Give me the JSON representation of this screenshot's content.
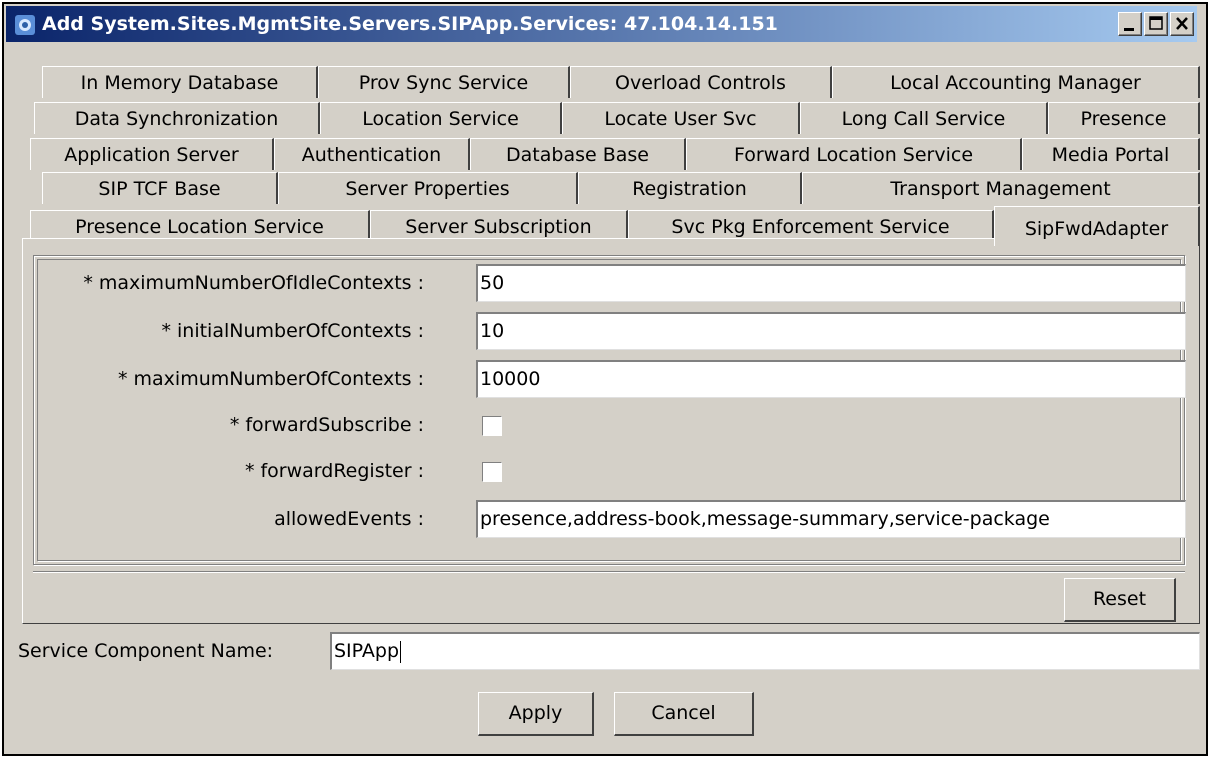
{
  "window": {
    "title": "Add System.Sites.MgmtSite.Servers.SIPApp.Services: 47.104.14.151",
    "icons": {
      "app": "network-icon",
      "minimize": "minimize-icon",
      "maximize": "maximize-icon",
      "close": "close-icon"
    }
  },
  "tabs": {
    "row1": [
      "In Memory Database",
      "Prov Sync Service",
      "Overload Controls",
      "Local Accounting Manager"
    ],
    "row2": [
      "Data Synchronization",
      "Location Service",
      "Locate User Svc",
      "Long Call Service",
      "Presence"
    ],
    "row3": [
      "Application Server",
      "Authentication",
      "Database Base",
      "Forward Location Service",
      "Media Portal"
    ],
    "row4": [
      "SIP TCF Base",
      "Server Properties",
      "Registration",
      "Transport Management"
    ],
    "row5": [
      "Presence Location Service",
      "Server Subscription",
      "Svc Pkg Enforcement Service",
      "SipFwdAdapter"
    ],
    "selected": "SipFwdAdapter"
  },
  "form": {
    "fields": [
      {
        "label": "* maximumNumberOfIdleContexts :",
        "value": "50"
      },
      {
        "label": "* initialNumberOfContexts :",
        "value": "10"
      },
      {
        "label": "* maximumNumberOfContexts :",
        "value": "10000"
      }
    ],
    "checkboxes": [
      {
        "label": "* forwardSubscribe :",
        "checked": false
      },
      {
        "label": "* forwardRegister :",
        "checked": false
      }
    ],
    "allowed_events": {
      "label": "allowedEvents :",
      "value": "presence,address-book,message-summary,service-package"
    },
    "reset_label": "Reset"
  },
  "service_component": {
    "label": "Service Component Name:",
    "value": "SIPApp"
  },
  "buttons": {
    "apply": "Apply",
    "cancel": "Cancel"
  }
}
